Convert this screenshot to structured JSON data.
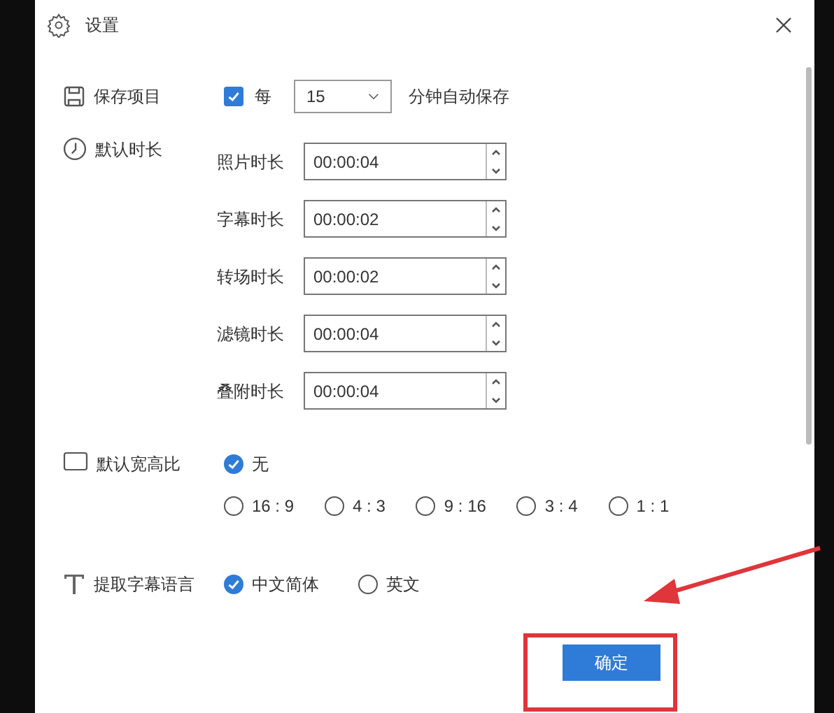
{
  "window": {
    "title": "设置"
  },
  "autosave": {
    "label": "保存项目",
    "checkbox": {
      "label": "每",
      "checked": true
    },
    "interval": {
      "value": "15"
    },
    "suffix": "分钟自动保存"
  },
  "default_durations": {
    "label": "默认时长",
    "fields": [
      {
        "label": "照片时长",
        "value": "00:00:04"
      },
      {
        "label": "字幕时长",
        "value": "00:00:02"
      },
      {
        "label": "转场时长",
        "value": "00:00:02"
      },
      {
        "label": "滤镜时长",
        "value": "00:00:04"
      },
      {
        "label": "叠附时长",
        "value": "00:00:04"
      }
    ]
  },
  "aspect_ratio": {
    "label": "默认宽高比",
    "options": [
      {
        "label": "无",
        "selected": true
      },
      {
        "label": "16 : 9",
        "selected": false
      },
      {
        "label": "4 : 3",
        "selected": false
      },
      {
        "label": "9 : 16",
        "selected": false
      },
      {
        "label": "3 : 4",
        "selected": false
      },
      {
        "label": "1 : 1",
        "selected": false
      }
    ]
  },
  "subtitle_language": {
    "label": "提取字幕语言",
    "options": [
      {
        "label": "中文简体",
        "selected": true
      },
      {
        "label": "英文",
        "selected": false
      }
    ]
  },
  "buttons": [
    {
      "label": "确定"
    }
  ]
}
